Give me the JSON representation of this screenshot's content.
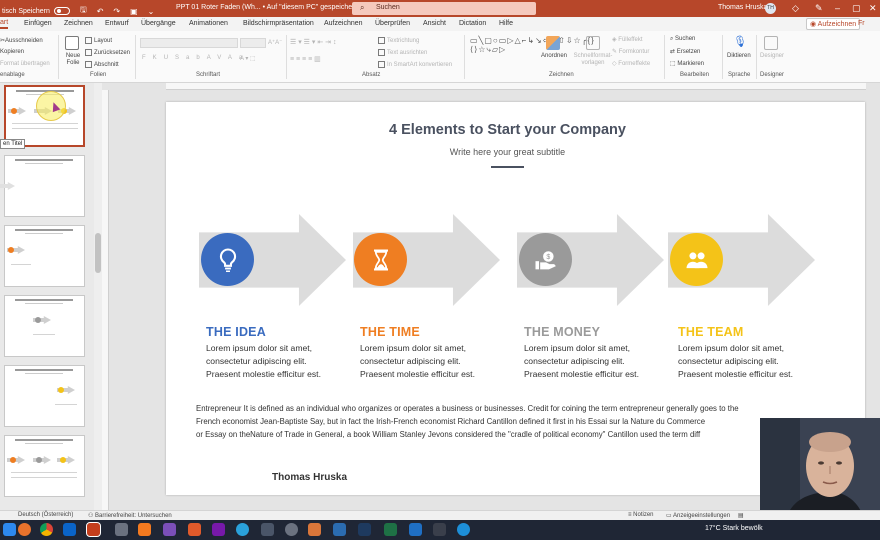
{
  "titlebar": {
    "autosave_label": "tisch Speichern",
    "doc_title": "PPT 01 Roter Faden (Wh... • Auf \"diesem PC\" gespeichert",
    "search_placeholder": "Suchen",
    "user_name": "Thomas Hruska",
    "user_initials": "TH"
  },
  "menu": {
    "tabs": [
      "art",
      "Einfügen",
      "Zeichnen",
      "Entwurf",
      "Übergänge",
      "Animationen",
      "Bildschirmpräsentation",
      "Aufzeichnen",
      "Überprüfen",
      "Ansicht",
      "Dictation",
      "Hilfe"
    ],
    "comments": "Aufzeichnen",
    "share": "Fr"
  },
  "ribbon": {
    "clipboard": {
      "cut": "Ausschneiden",
      "copy": "Kopieren",
      "format": "Format übertragen",
      "group": "enablage"
    },
    "slides": {
      "new_slide": "Neue Folie",
      "layout": "Layout",
      "reset": "Zurücksetzen",
      "section": "Abschnitt",
      "group": "Folien"
    },
    "font": {
      "group": "Schriftart",
      "buttons": [
        "F",
        "K",
        "U",
        "S",
        "ab",
        "AV",
        "Aa"
      ]
    },
    "paragraph": {
      "text_dir": "Textrichtung",
      "align_text": "Text ausrichten",
      "smartart": "In SmartArt konvertieren",
      "group": "Absatz"
    },
    "drawing": {
      "arrange": "Anordnen",
      "quick_styles": "Schnellformat-vorlagen",
      "fill": "Fülleffekt",
      "outline": "Formkontur",
      "effects": "Formeffekte",
      "group": "Zeichnen"
    },
    "editing": {
      "find": "Suchen",
      "replace": "Ersetzen",
      "select": "Markieren",
      "group": "Bearbeiten"
    },
    "voice": {
      "dictate": "Diktieren",
      "group": "Sprache"
    },
    "designer": {
      "label": "Designer",
      "group": "Designer"
    }
  },
  "left_pane": {
    "tooltip": "en Titel"
  },
  "slide": {
    "title": "4 Elements to Start your Company",
    "subtitle": "Write here your great subtitle",
    "elements": [
      {
        "title": "THE IDEA",
        "color": "#3a6bbf",
        "icon": "lightbulb-icon",
        "lines": [
          "Lorem ipsum dolor sit amet,",
          "consectetur adipiscing elit.",
          "Praesent molestie efficitur est."
        ]
      },
      {
        "title": "THE TIME",
        "color": "#ef7e22",
        "icon": "hourglass-icon",
        "lines": [
          "Lorem ipsum dolor sit amet,",
          "consectetur adipiscing elit.",
          "Praesent molestie efficitur est."
        ]
      },
      {
        "title": "THE MONEY",
        "color": "#9a9a9a",
        "icon": "money-hand-icon",
        "lines": [
          "Lorem ipsum dolor sit amet,",
          "consectetur adipiscing elit.",
          "Praesent molestie efficitur est."
        ]
      },
      {
        "title": "THE TEAM",
        "color": "#f4c318",
        "icon": "team-icon",
        "lines": [
          "Lorem ipsum dolor sit amet,",
          "consectetur adipiscing elit.",
          "Praesent molestie efficitur est."
        ]
      }
    ],
    "paragraph_lines": [
      "Entrepreneur  It is defined as an individual who organizes or operates a business or businesses. Credit for coining the term entrepreneur generally goes to the",
      "French economist Jean-Baptiste Say, but in fact the Irish-French economist Richard Cantillon defined it first in his Essai sur la Nature du Commerce",
      "or Essay on theNature of Trade in General, a book William Stanley Jevons considered the \"cradle of political economy\" Cantillon used the term diff"
    ],
    "author": "Thomas Hruska"
  },
  "status": {
    "language": "Deutsch (Österreich)",
    "accessibility": "Barrierefreiheit: Untersuchen",
    "notes": "Notizen",
    "display": "Anzeigeeinstellungen"
  },
  "taskbar": {
    "weather": "17°C  Stark bewölk"
  }
}
